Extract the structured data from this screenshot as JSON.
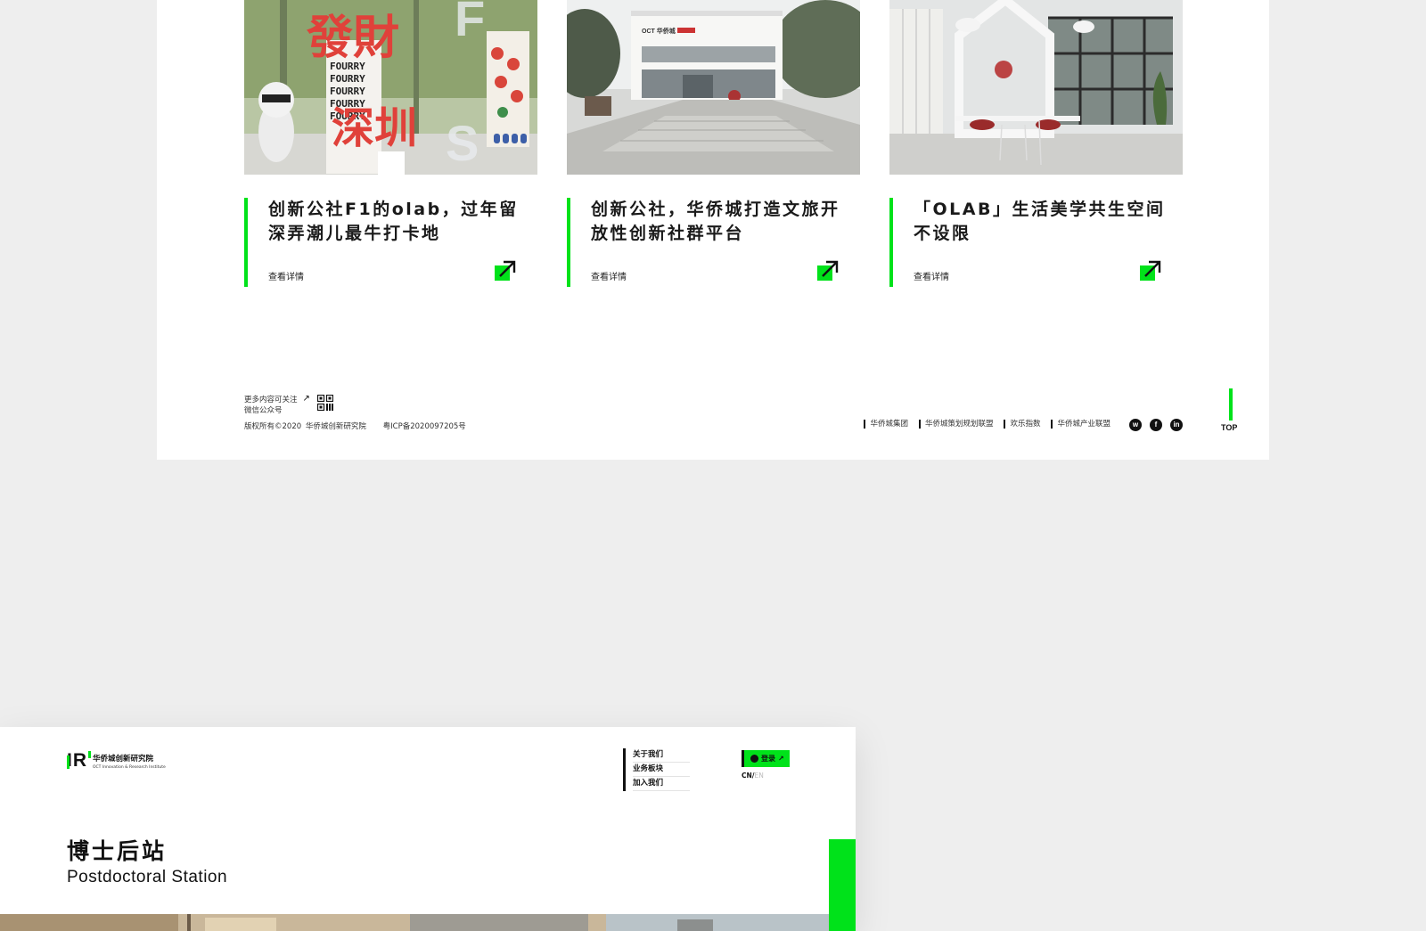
{
  "articles": [
    {
      "title": "创新公社F1的olab，过年留深弄潮儿最牛打卡地",
      "more": "查看详情"
    },
    {
      "title": "创新公社，华侨城打造文旅开放性创新社群平台",
      "more": "查看详情"
    },
    {
      "title": "「OLAB」生活美学共生空间不设限",
      "more": "查看详情"
    }
  ],
  "footer": {
    "follow_line1": "更多内容可关注",
    "follow_line2": "微信公众号",
    "follow_arrow": "↗",
    "copyright": "版权所有©2020 华侨城创新研究院",
    "icp": "粤ICP备2020097205号",
    "links": [
      "华侨城集团",
      "华侨城策划规划联盟",
      "欢乐指数",
      "华侨城产业联盟"
    ],
    "social": [
      {
        "name": "weibo-icon",
        "glyph": "w"
      },
      {
        "name": "facebook-icon",
        "glyph": "f"
      },
      {
        "name": "linkedin-icon",
        "glyph": "in"
      }
    ],
    "top_label": "TOP"
  },
  "preview": {
    "logo_mark": "IR",
    "logo_cn": "华侨城创新研究院",
    "logo_en": "OCT Innovation & Research Institute",
    "nav": [
      "关于我们",
      "业务板块",
      "加入我们"
    ],
    "login_label": "登录",
    "login_arrow": "↗",
    "lang_cn": "CN",
    "lang_sep": "/",
    "lang_en": "EN",
    "title_cn": "博士后站",
    "title_en": "Postdoctoral Station"
  },
  "colors": {
    "accent": "#00e21a",
    "background": "#eeeeee",
    "card": "#ffffff",
    "text": "#111111"
  }
}
